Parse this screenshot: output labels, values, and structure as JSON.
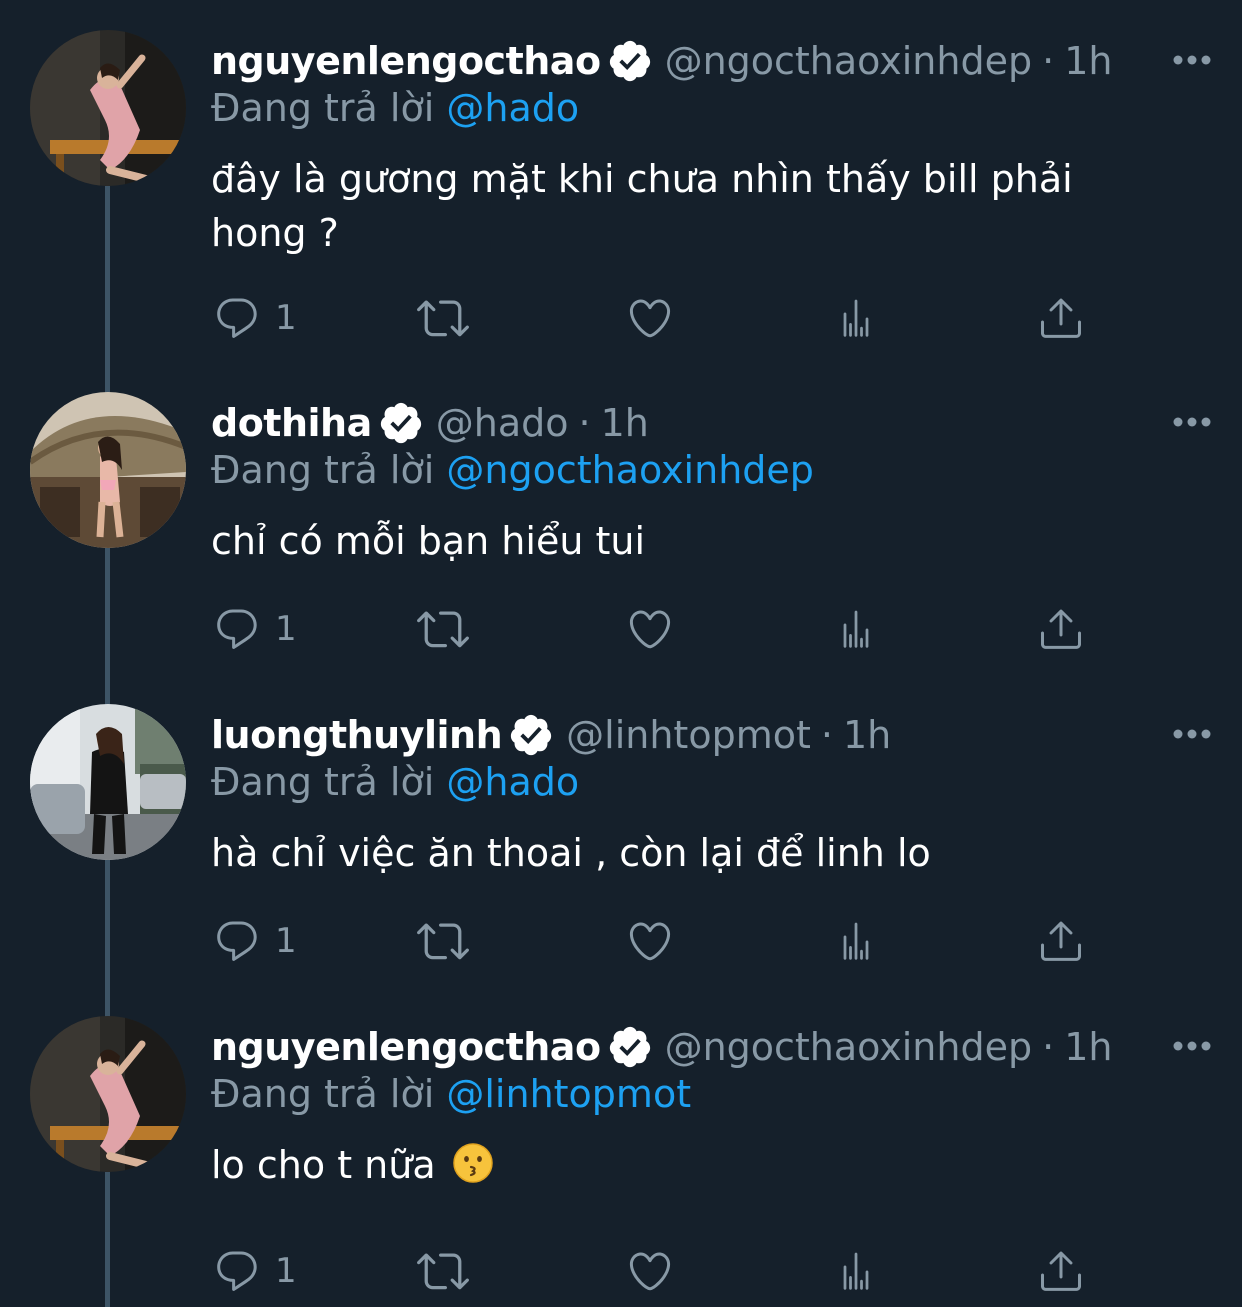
{
  "reply_prefix": "Đang trả lời",
  "dot": "·",
  "colors": {
    "background": "#15202b",
    "text": "#ffffff",
    "secondary": "#8899a6",
    "accent": "#1da1f2",
    "thread_line": "#3d5466"
  },
  "icons": [
    "verified-badge-icon",
    "more-options-icon",
    "reply-icon",
    "retweet-icon",
    "like-icon",
    "analytics-icon",
    "share-icon"
  ],
  "tweets": [
    {
      "display_name": "nguyenlengocthao",
      "handle": "@ngocthaoxinhdep",
      "time": "1h",
      "reply_to": "@hado",
      "text_line1": "đây là gương mặt khi chưa nhìn thấy bill phải",
      "text_line2": "hong ?",
      "reply_count": "1"
    },
    {
      "display_name": "dothiha",
      "handle": "@hado",
      "time": "1h",
      "reply_to": "@ngocthaoxinhdep",
      "text_line1": "chỉ có mỗi bạn hiểu tui",
      "reply_count": "1"
    },
    {
      "display_name": "luongthuylinh",
      "handle": "@linhtopmot",
      "time": "1h",
      "reply_to": "@hado",
      "text_line1": "hà chỉ việc ăn thoai , còn lại để linh lo",
      "reply_count": "1"
    },
    {
      "display_name": "nguyenlengocthao",
      "handle": "@ngocthaoxinhdep",
      "time": "1h",
      "reply_to": "@linhtopmot",
      "text_line1": "lo cho t nữa",
      "emoji": "kissing-face-emoji",
      "reply_count": "1"
    }
  ]
}
